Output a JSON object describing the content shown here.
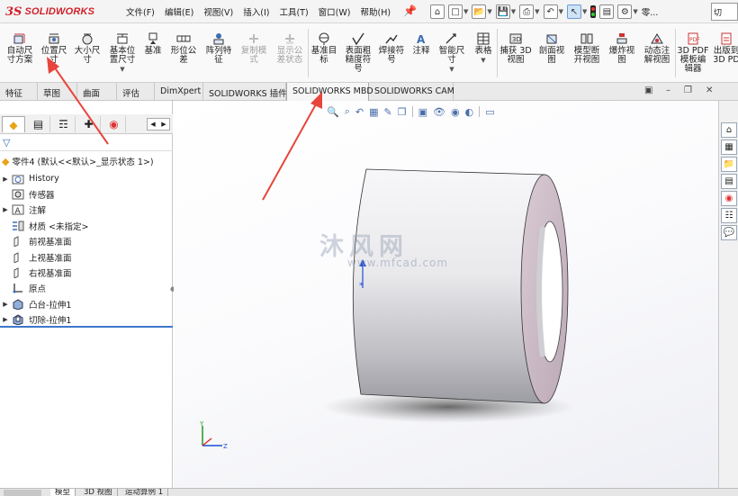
{
  "app": {
    "logo_ds": "3S",
    "logo_name": "SOLIDWORKS"
  },
  "menu": [
    "文件(F)",
    "编辑(E)",
    "视图(V)",
    "插入(I)",
    "工具(T)",
    "窗口(W)",
    "帮助(H)"
  ],
  "quick_access": {
    "more_label": "零...",
    "search_tail": "切"
  },
  "ribbon": {
    "buttons": [
      {
        "label": "自动尺\n寸方案",
        "icon": "auto-dimension-scheme-icon",
        "disabled": false
      },
      {
        "label": "位置尺\n寸",
        "icon": "location-dimension-icon",
        "disabled": false
      },
      {
        "label": "大小尺\n寸",
        "icon": "size-dimension-icon",
        "disabled": false
      },
      {
        "label": "基本位\n置尺寸",
        "icon": "basic-location-dimension-icon",
        "disabled": false
      },
      {
        "label": "基准",
        "icon": "datum-icon",
        "disabled": false
      },
      {
        "label": "形位公\n差",
        "icon": "geometric-tolerance-icon",
        "disabled": false
      },
      {
        "label": "阵列特\n征",
        "icon": "pattern-feature-icon",
        "disabled": false
      },
      {
        "label": "复制模\n式",
        "icon": "copy-scheme-icon",
        "disabled": true
      },
      {
        "label": "显示公\n差状态",
        "icon": "show-tolerance-status-icon",
        "disabled": true
      },
      {
        "label": "基准目\n标",
        "icon": "datum-target-icon",
        "disabled": false
      },
      {
        "label": "表面粗\n糙度符\n号",
        "icon": "surface-finish-icon",
        "disabled": false
      },
      {
        "label": "焊接符\n号",
        "icon": "weld-symbol-icon",
        "disabled": false
      },
      {
        "label": "注释",
        "icon": "note-icon",
        "disabled": false
      },
      {
        "label": "智能尺\n寸",
        "icon": "smart-dimension-icon",
        "disabled": false
      },
      {
        "label": "表格",
        "icon": "table-icon",
        "disabled": false
      },
      {
        "label": "捕获 3D\n视图",
        "icon": "capture-3d-view-icon",
        "disabled": false
      },
      {
        "label": "剖面视\n图",
        "icon": "section-view-icon",
        "disabled": false
      },
      {
        "label": "模型断\n开视图",
        "icon": "model-break-view-icon",
        "disabled": false
      },
      {
        "label": "爆炸视\n图",
        "icon": "exploded-view-icon",
        "disabled": false
      },
      {
        "label": "动态注\n解视图",
        "icon": "dynamic-annotation-views-icon",
        "disabled": false
      },
      {
        "label": "3D PDF\n模板编\n辑器",
        "icon": "3d-pdf-template-editor-icon",
        "disabled": false
      },
      {
        "label": "出版到\n3D PD",
        "icon": "publish-3d-pdf-icon",
        "disabled": false
      }
    ]
  },
  "tabs": [
    "特征",
    "草图",
    "曲面",
    "评估",
    "DimXpert",
    "SOLIDWORKS 插件",
    "SOLIDWORKS MBD",
    "SOLIDWORKS CAM"
  ],
  "active_tab": "SOLIDWORKS MBD",
  "feature_tree": {
    "root": "零件4 (默认<<默认>_显示状态 1>)",
    "items": [
      {
        "label": "History",
        "expandable": true,
        "icon": "history-folder-icon"
      },
      {
        "label": "传感器",
        "expandable": false,
        "icon": "sensor-icon"
      },
      {
        "label": "注解",
        "expandable": true,
        "icon": "annotations-icon"
      },
      {
        "label": "材质 <未指定>",
        "expandable": false,
        "icon": "material-icon"
      },
      {
        "label": "前视基准面",
        "expandable": false,
        "icon": "plane-icon"
      },
      {
        "label": "上视基准面",
        "expandable": false,
        "icon": "plane-icon"
      },
      {
        "label": "右视基准面",
        "expandable": false,
        "icon": "plane-icon"
      },
      {
        "label": "原点",
        "expandable": false,
        "icon": "origin-icon"
      },
      {
        "label": "凸台-拉伸1",
        "expandable": true,
        "icon": "boss-extrude-icon"
      },
      {
        "label": "切除-拉伸1",
        "expandable": true,
        "icon": "cut-extrude-icon"
      }
    ]
  },
  "viewport": {
    "watermark_cn": "沐风网",
    "watermark_en": "www.mfcad.com",
    "triad": {
      "y": "Y",
      "z": "Z",
      "x": "X"
    }
  },
  "bottom_tabs": [
    "模型",
    "3D 视图",
    "运动算例 1"
  ],
  "colors": {
    "accent_red": "#d0202a",
    "tab_underline": "#3c78c8",
    "annotation_arrow": "#e8453c"
  }
}
